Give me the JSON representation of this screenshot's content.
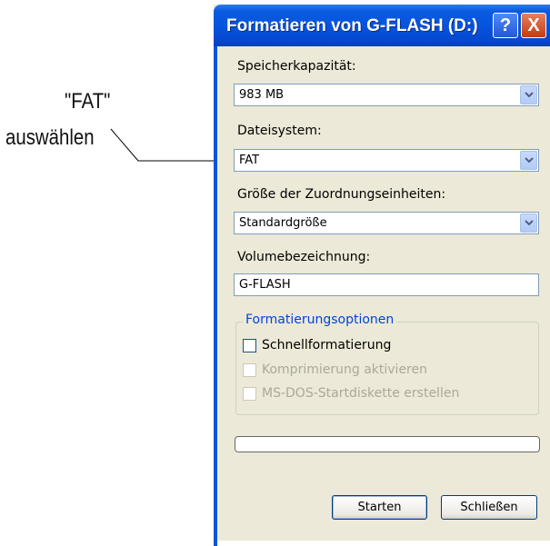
{
  "annotation": {
    "line1": "\"FAT\"",
    "line2": "auswählen"
  },
  "window": {
    "title": "Formatieren von G-FLASH (D:)",
    "help_button": "?",
    "close_button": "X"
  },
  "capacity": {
    "label": "Speicherkapazität:",
    "value": "983 MB"
  },
  "filesystem": {
    "label": "Dateisystem:",
    "value": "FAT"
  },
  "allocation": {
    "label": "Größe der Zuordnungseinheiten:",
    "value": "Standardgröße"
  },
  "volume": {
    "label": "Volumebezeichnung:",
    "value": "G-FLASH"
  },
  "options": {
    "title": "Formatierungsoptionen",
    "quick_format": "Schnellformatierung",
    "compression": "Komprimierung aktivieren",
    "msdos": "MS-DOS-Startdiskette erstellen"
  },
  "progress": {
    "value": 0
  },
  "buttons": {
    "start": "Starten",
    "close": "Schließen"
  },
  "colors": {
    "titlebar": "#0654de",
    "dialog_bg": "#ece9d8",
    "group_title": "#0046d5"
  }
}
